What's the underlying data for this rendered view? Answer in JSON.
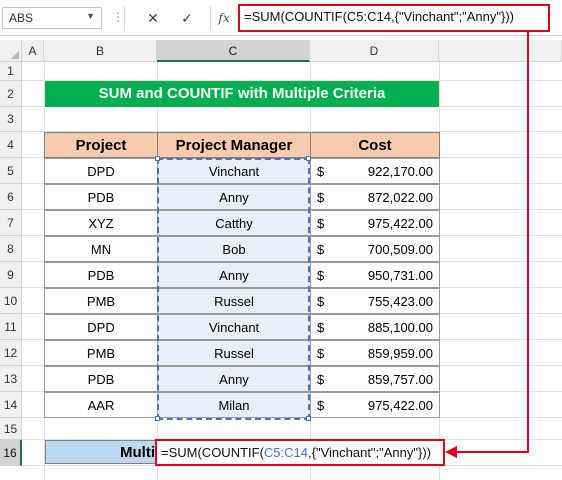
{
  "formula_bar": {
    "name_box": "ABS",
    "cancel_icon": "✕",
    "enter_icon": "✓",
    "fx_label": "fx",
    "formula": "=SUM(COUNTIF(C5:C14,{\"Vinchant\";\"Anny\"}))"
  },
  "columns": [
    "A",
    "B",
    "C",
    "D"
  ],
  "rows": [
    "1",
    "2",
    "3",
    "4",
    "5",
    "6",
    "7",
    "8",
    "9",
    "10",
    "11",
    "12",
    "13",
    "14",
    "15",
    "16"
  ],
  "title": "SUM and COUNTIF with Multiple Criteria",
  "table": {
    "headers": [
      "Project",
      "Project Manager",
      "Cost"
    ],
    "currency": "$",
    "rows": [
      [
        "DPD",
        "Vinchant",
        "922,170.00"
      ],
      [
        "PDB",
        "Anny",
        "872,022.00"
      ],
      [
        "XYZ",
        "Catthy",
        "975,422.00"
      ],
      [
        "MN",
        "Bob",
        "700,509.00"
      ],
      [
        "PDB",
        "Anny",
        "950,731.00"
      ],
      [
        "PMB",
        "Russel",
        "755,423.00"
      ],
      [
        "DPD",
        "Vinchant",
        "885,100.00"
      ],
      [
        "PMB",
        "Russel",
        "859,959.00"
      ],
      [
        "PDB",
        "Anny",
        "859,757.00"
      ],
      [
        "AAR",
        "Milan",
        "975,422.00"
      ]
    ]
  },
  "row16": {
    "label": "Multi",
    "formula_pre": "=SUM(COUNTIF(",
    "formula_ref": "C5:C14",
    "formula_post": ",{\"Vinchant\";\"Anny\"}))"
  },
  "colors": {
    "title_bg": "#00b050",
    "header_bg": "#f8cbad",
    "highlight_red": "#e0001b",
    "selection_blue": "#4472c4",
    "label_bg": "#bdd7ee"
  }
}
